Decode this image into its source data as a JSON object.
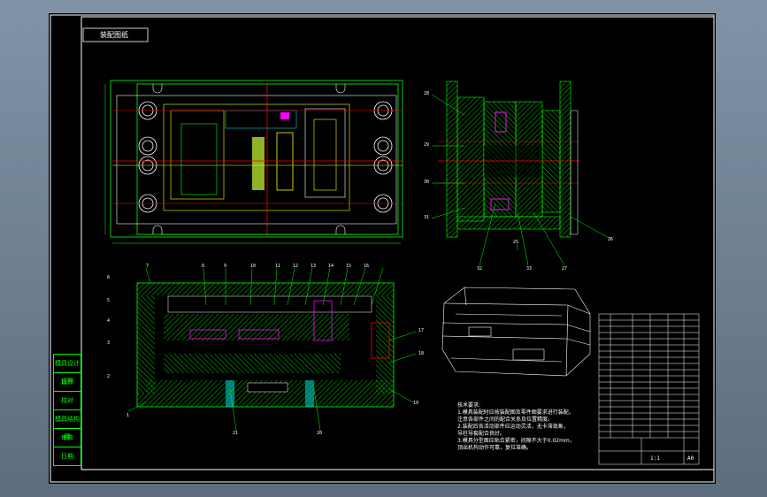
{
  "drawing": {
    "title_label": "装配图纸",
    "scale_label": "1:1",
    "sheet_label": "A0"
  },
  "side_table": {
    "rows": [
      "模具设计说明",
      "设计",
      "校对",
      "模具结构图",
      "审核",
      "日期"
    ]
  },
  "tech_requirements": {
    "heading": "技术要求:",
    "lines": [
      "1.模具装配时应按装配图及零件图要求进行装配，",
      "   注意各部件之间的配合关系及位置精度。",
      "2.装配后各活动部件应运动灵活，无卡滞现象，",
      "   导柱导套配合良好。",
      "3.模具分型面应贴合紧密，间隙不大于0.02mm，",
      "   顶出机构动作可靠，复位准确。"
    ]
  },
  "part_numbers_top": [
    "7",
    "8",
    "9",
    "10",
    "11",
    "12",
    "13",
    "14",
    "15",
    "16"
  ],
  "part_numbers_left": [
    "6",
    "5",
    "4",
    "3",
    "2",
    "1"
  ],
  "part_numbers_right": [
    "17",
    "18",
    "19"
  ],
  "part_numbers_bottom": [
    "21",
    "20"
  ],
  "section_numbers": [
    "28",
    "29",
    "30",
    "31",
    "32",
    "33",
    "27",
    "26",
    "25"
  ],
  "colors": {
    "background": "#000000",
    "border": "#ffffff",
    "hatch": "#00ff00",
    "construction": "#ff0000",
    "outline": "#ffff00",
    "accent": "#ff00ff",
    "cyan": "#00ffff"
  }
}
